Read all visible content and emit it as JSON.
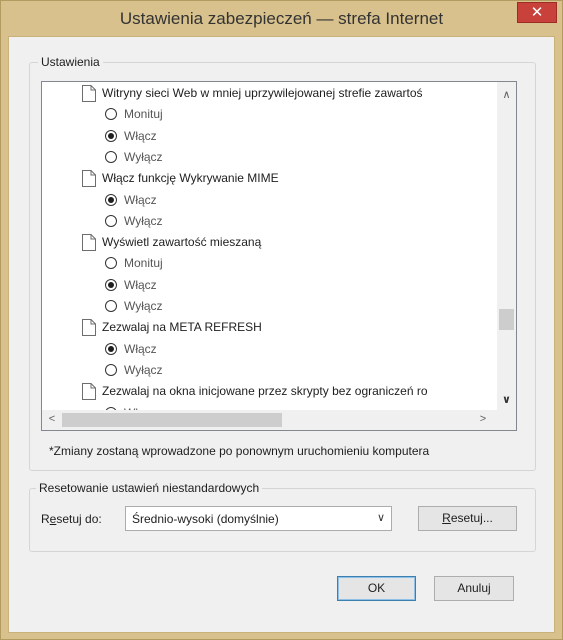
{
  "window": {
    "title": "Ustawienia zabezpieczeń — strefa Internet",
    "close_glyph": "✕"
  },
  "settings_group": {
    "label": "Ustawienia"
  },
  "settings_list": {
    "items": [
      {
        "kind": "heading",
        "text": "Witryny sieci Web w mniej uprzywilejowanej strefie zawartoś"
      },
      {
        "kind": "option",
        "text": "Monituj",
        "checked": false
      },
      {
        "kind": "option",
        "text": "Włącz",
        "checked": true
      },
      {
        "kind": "option",
        "text": "Wyłącz",
        "checked": false
      },
      {
        "kind": "heading",
        "text": "Włącz funkcję Wykrywanie MIME"
      },
      {
        "kind": "option",
        "text": "Włącz",
        "checked": true
      },
      {
        "kind": "option",
        "text": "Wyłącz",
        "checked": false
      },
      {
        "kind": "heading",
        "text": "Wyświetl zawartość mieszaną"
      },
      {
        "kind": "option",
        "text": "Monituj",
        "checked": false
      },
      {
        "kind": "option",
        "text": "Włącz",
        "checked": true
      },
      {
        "kind": "option",
        "text": "Wyłącz",
        "checked": false
      },
      {
        "kind": "heading",
        "text": "Zezwalaj na META REFRESH"
      },
      {
        "kind": "option",
        "text": "Włącz",
        "checked": true
      },
      {
        "kind": "option",
        "text": "Wyłącz",
        "checked": false
      },
      {
        "kind": "heading",
        "text": "Zezwalaj na okna inicjowane przez skrypty bez ograniczeń ro"
      },
      {
        "kind": "option",
        "text": "Włącz",
        "checked": false
      }
    ],
    "scroll": {
      "up": "∧",
      "down": "∨",
      "left": "<",
      "right": ">"
    }
  },
  "note": "*Zmiany zostaną wprowadzone po ponownym uruchomieniu komputera",
  "reset_group": {
    "label": "Resetowanie ustawień niestandardowych",
    "reset_to_prefix": "R",
    "reset_to_underlined": "e",
    "reset_to_suffix": "setuj do:",
    "selected_value": "Średnio-wysoki (domyślnie)",
    "select_arrow": "∨",
    "reset_button_underlined": "R",
    "reset_button_suffix": "esetuj..."
  },
  "buttons": {
    "ok": "OK",
    "cancel": "Anuluj"
  }
}
